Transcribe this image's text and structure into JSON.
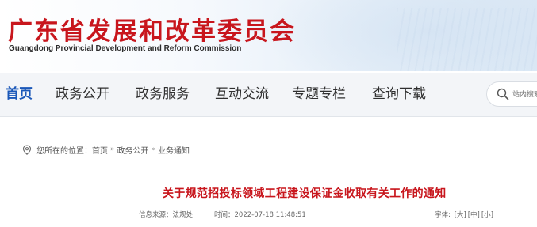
{
  "header": {
    "title": "广东省发展和改革委员会",
    "subtitle": "Guangdong Provincial Development and Reform Commission"
  },
  "nav": {
    "items": [
      {
        "label": "首页",
        "active": true
      },
      {
        "label": "政务公开",
        "active": false
      },
      {
        "label": "政务服务",
        "active": false
      },
      {
        "label": "互动交流",
        "active": false
      },
      {
        "label": "专题专栏",
        "active": false
      },
      {
        "label": "查询下载",
        "active": false
      }
    ],
    "search": {
      "placeholder": "站内搜索",
      "icon": "search-icon"
    }
  },
  "breadcrumb": {
    "prefix": "您所在的位置：",
    "icon": "location-pin-icon",
    "items": [
      "首页",
      "政务公开",
      "业务通知"
    ],
    "separator": "»"
  },
  "article": {
    "title": "关于规范招投标领域工程建设保证金收取有关工作的通知",
    "source_label": "信息来源：法规处",
    "time_label": "时间：2022-07-18 11:48:51",
    "font_size_label": "字体:",
    "font_sizes": [
      "[大]",
      "[中]",
      "[小]"
    ]
  },
  "colors": {
    "brand_red": "#c8161d",
    "nav_active_blue": "#1a57b8",
    "nav_background": "#f3f5f8"
  }
}
